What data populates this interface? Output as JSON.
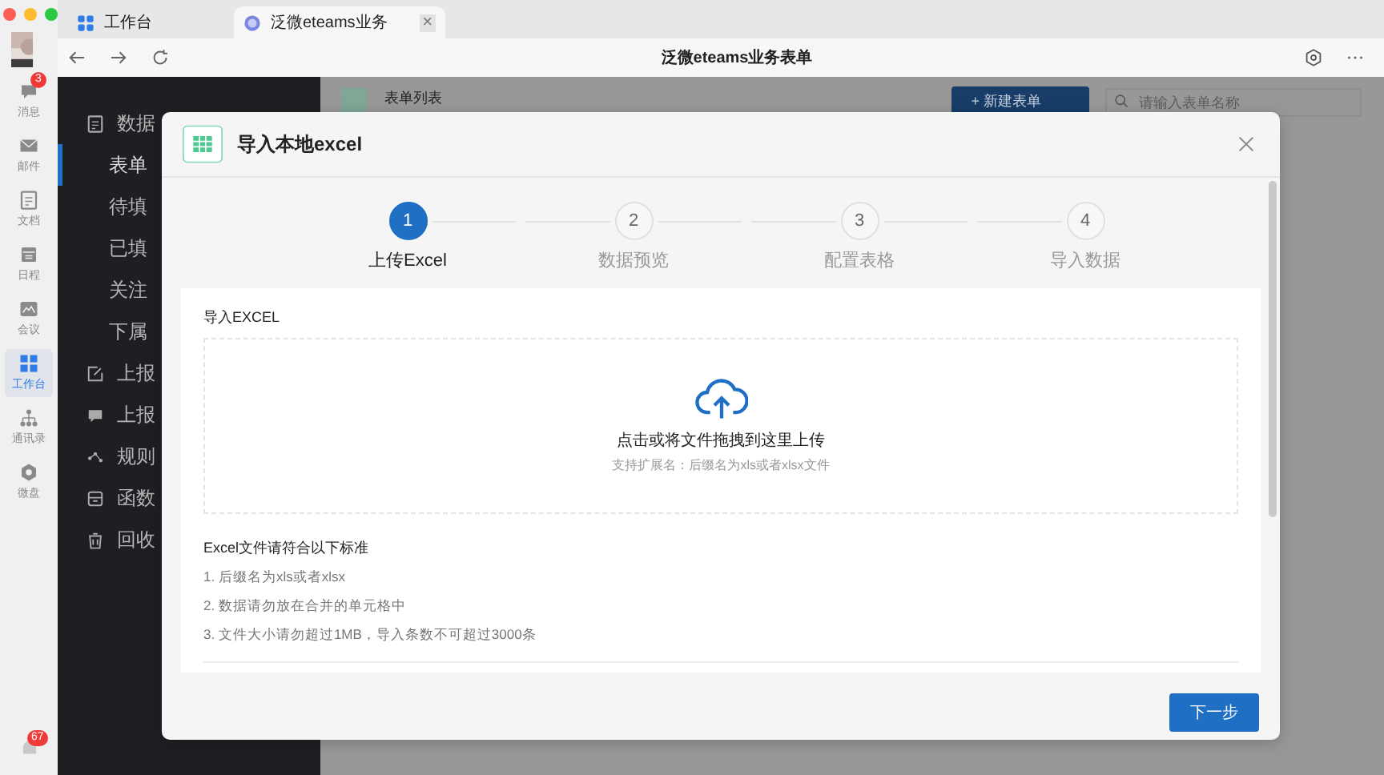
{
  "rail": {
    "items": [
      {
        "label": "消息",
        "badge": "3",
        "selected": false
      },
      {
        "label": "邮件",
        "selected": false
      },
      {
        "label": "文档",
        "selected": false
      },
      {
        "label": "日程",
        "selected": false
      },
      {
        "label": "会议",
        "selected": false
      },
      {
        "label": "工作台",
        "selected": true
      },
      {
        "label": "通讯录",
        "selected": false
      },
      {
        "label": "微盘",
        "selected": false
      }
    ],
    "bottom_badge": "67"
  },
  "tabs": [
    {
      "label": "工作台",
      "selected": false
    },
    {
      "label": "泛微eteams业务",
      "selected": true,
      "close": "×"
    }
  ],
  "toolbar": {
    "title": "泛微eteams业务表单"
  },
  "sidebar": {
    "items": [
      {
        "label": "数据",
        "selected": false,
        "children": [
          {
            "label": "表单",
            "selected": true
          },
          {
            "label": "待填",
            "selected": false
          },
          {
            "label": "已填",
            "selected": false
          },
          {
            "label": "关注",
            "selected": false
          },
          {
            "label": "下属",
            "selected": false
          }
        ]
      },
      {
        "label": "上报",
        "selected": false
      },
      {
        "label": "上报",
        "selected": false
      },
      {
        "label": "规则",
        "selected": false
      },
      {
        "label": "函数",
        "selected": false
      },
      {
        "label": "回收",
        "selected": false
      }
    ]
  },
  "page": {
    "title": "表单列表",
    "new_button": "+ 新建表单",
    "search_placeholder": "请输入表单名称"
  },
  "modal": {
    "title": "导入本地excel",
    "steps": [
      {
        "number": "1",
        "label": "上传Excel",
        "selected": true
      },
      {
        "number": "2",
        "label": "数据预览",
        "selected": false
      },
      {
        "number": "3",
        "label": "配置表格",
        "selected": false
      },
      {
        "number": "4",
        "label": "导入数据",
        "selected": false
      }
    ],
    "section_label": "导入EXCEL",
    "upload": {
      "text": "点击或将文件拖拽到这里上传",
      "hint": "支持扩展名：后缀名为xls或者xlsx文件"
    },
    "rules_title": "Excel文件请符合以下标准",
    "rules": [
      "1. 后缀名为xls或者xlsx",
      "2. 数据请勿放在合并的单元格中",
      "3. 文件大小请勿超过1MB，导入条数不可超过3000条"
    ],
    "next_button": "下一步"
  }
}
